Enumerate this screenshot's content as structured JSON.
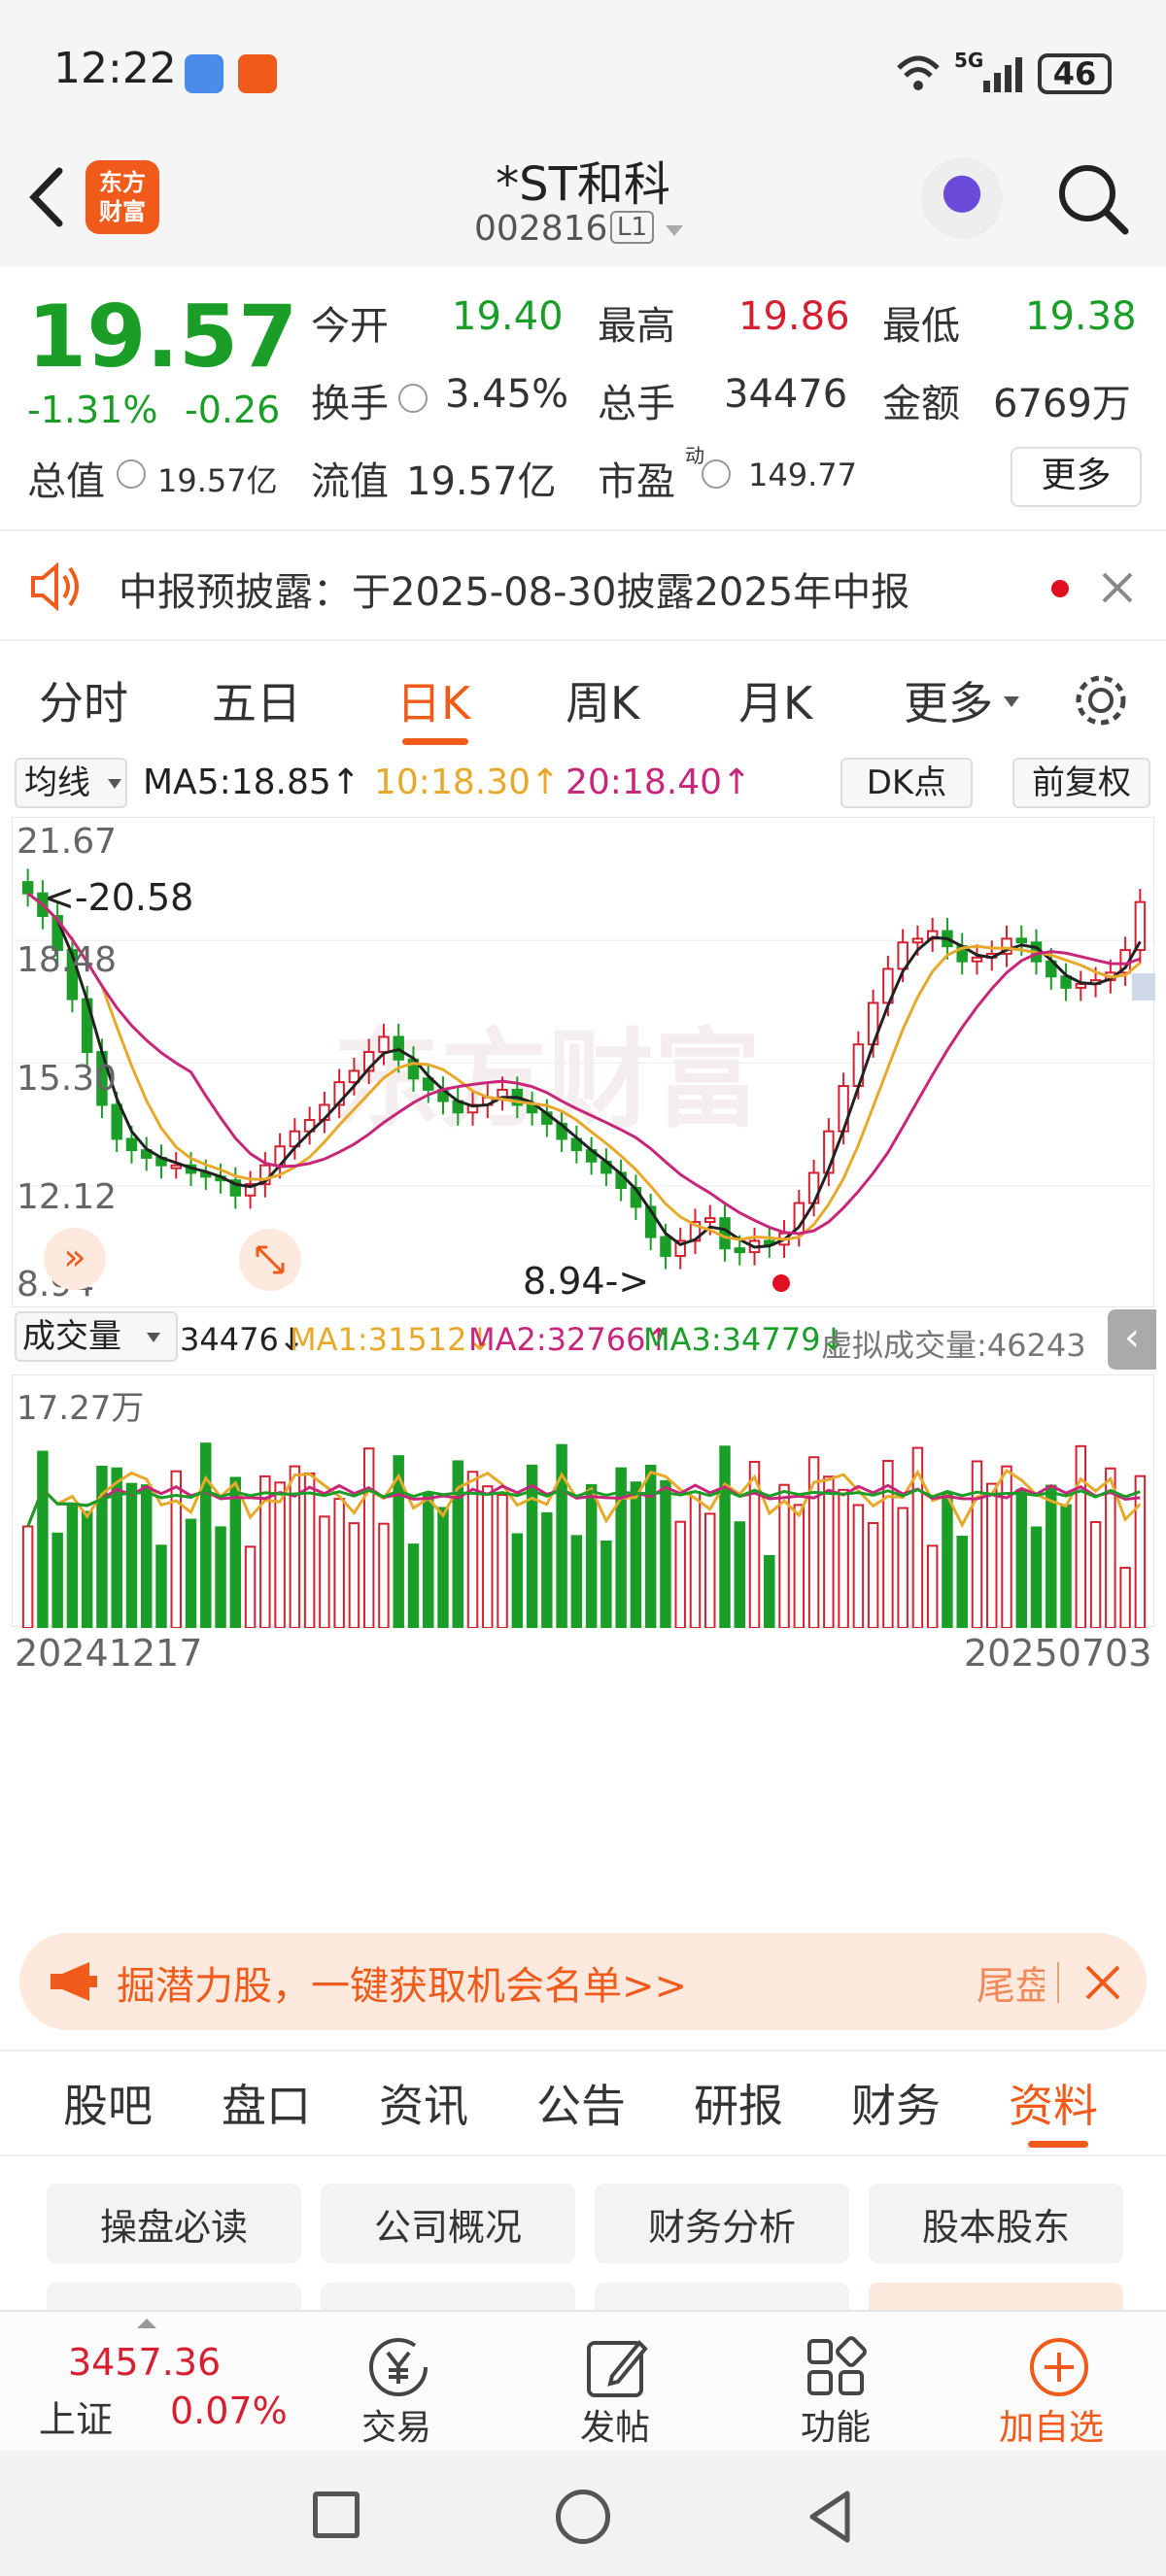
{
  "status": {
    "time": "12:22",
    "net": "5G",
    "battery": "46"
  },
  "header": {
    "logo": "东方\n财富",
    "stock_name": "*ST和科",
    "stock_code": "002816",
    "level_badge": "L1"
  },
  "quote": {
    "price": "19.57",
    "pct": "-1.31%",
    "chg": "-0.26",
    "open_label": "今开",
    "open": "19.40",
    "high_label": "最高",
    "high": "19.86",
    "low_label": "最低",
    "low": "19.38",
    "turnover_label": "换手",
    "turnover": "3.45%",
    "volume_label": "总手",
    "volume": "34476",
    "amount_label": "金额",
    "amount": "6769万",
    "mcap_label": "总值",
    "mcap": "19.57亿",
    "float_label": "流值",
    "float": "19.57亿",
    "pe_label": "市盈",
    "pe_sup": "动",
    "pe": "149.77",
    "more": "更多"
  },
  "notice": {
    "text": "中报预披露：于2025-08-30披露2025年中报"
  },
  "tabs": [
    "分时",
    "五日",
    "日K",
    "周K",
    "月K",
    "更多"
  ],
  "active_tab": "日K",
  "kline": {
    "indicator": "均线",
    "ma5": "MA5:18.85↑",
    "ma10": "10:18.30↑",
    "ma20": "20:18.40↑",
    "dk": "DK点",
    "fq": "前复权",
    "y_ticks": [
      "21.67",
      "18.48",
      "15.30",
      "12.12",
      "8.94"
    ],
    "max_label": "<-20.58",
    "min_label": "8.94->",
    "watermark": "东方财富"
  },
  "volume": {
    "label": "成交量",
    "value": "34476↓",
    "ma1": "MA1:31512↓",
    "ma2": "MA2:32766↑",
    "ma3": "MA3:34779↓",
    "virtual": "虚拟成交量:46243",
    "y_tick": "17.27万",
    "start_date": "20241217",
    "end_date": "20250703"
  },
  "banner": {
    "text": "掘潜力股，一键获取机会名单>>",
    "right": "尾盘"
  },
  "subtabs": [
    "股吧",
    "盘口",
    "资讯",
    "公告",
    "研报",
    "财务",
    "资料"
  ],
  "active_subtab": "资料",
  "quick": [
    "操盘必读",
    "公司概况",
    "财务分析",
    "股本股东"
  ],
  "bottom": {
    "index_value": "3457.36",
    "index_name": "上证",
    "index_pct": "0.07%",
    "items": [
      "交易",
      "发帖",
      "功能",
      "加自选"
    ]
  },
  "colors": {
    "up": "#d42030",
    "down": "#1a9e28",
    "accent": "#f05a1a",
    "ma5": "#222222",
    "ma10": "#e8a92a",
    "ma20": "#c8267a"
  },
  "chart_data": {
    "type": "candlestick",
    "x_range": [
      "20241217",
      "20250703"
    ],
    "price_range": [
      8.94,
      21.67
    ],
    "annotations": [
      "<-20.58",
      "8.94->"
    ],
    "closes": [
      19.8,
      19.2,
      18.3,
      17.0,
      15.6,
      14.2,
      13.3,
      13.0,
      12.8,
      12.6,
      12.6,
      12.4,
      12.3,
      12.2,
      11.8,
      12.1,
      12.6,
      13.1,
      13.5,
      13.8,
      14.2,
      14.8,
      15.1,
      15.6,
      16.0,
      15.4,
      14.9,
      14.6,
      14.3,
      14.0,
      14.2,
      14.4,
      14.6,
      14.2,
      14.0,
      13.7,
      13.3,
      13.0,
      12.7,
      12.4,
      12.0,
      11.5,
      10.7,
      10.2,
      10.6,
      11.1,
      11.2,
      10.4,
      10.3,
      10.6,
      10.5,
      10.8,
      11.6,
      12.4,
      13.5,
      14.7,
      15.8,
      16.9,
      17.8,
      18.5,
      18.6,
      18.8,
      18.4,
      18.0,
      18.1,
      18.2,
      18.6,
      18.5,
      18.0,
      17.6,
      17.3,
      17.4,
      17.5,
      17.7,
      18.3,
      19.57
    ],
    "vol_range_max": "17.27万"
  }
}
